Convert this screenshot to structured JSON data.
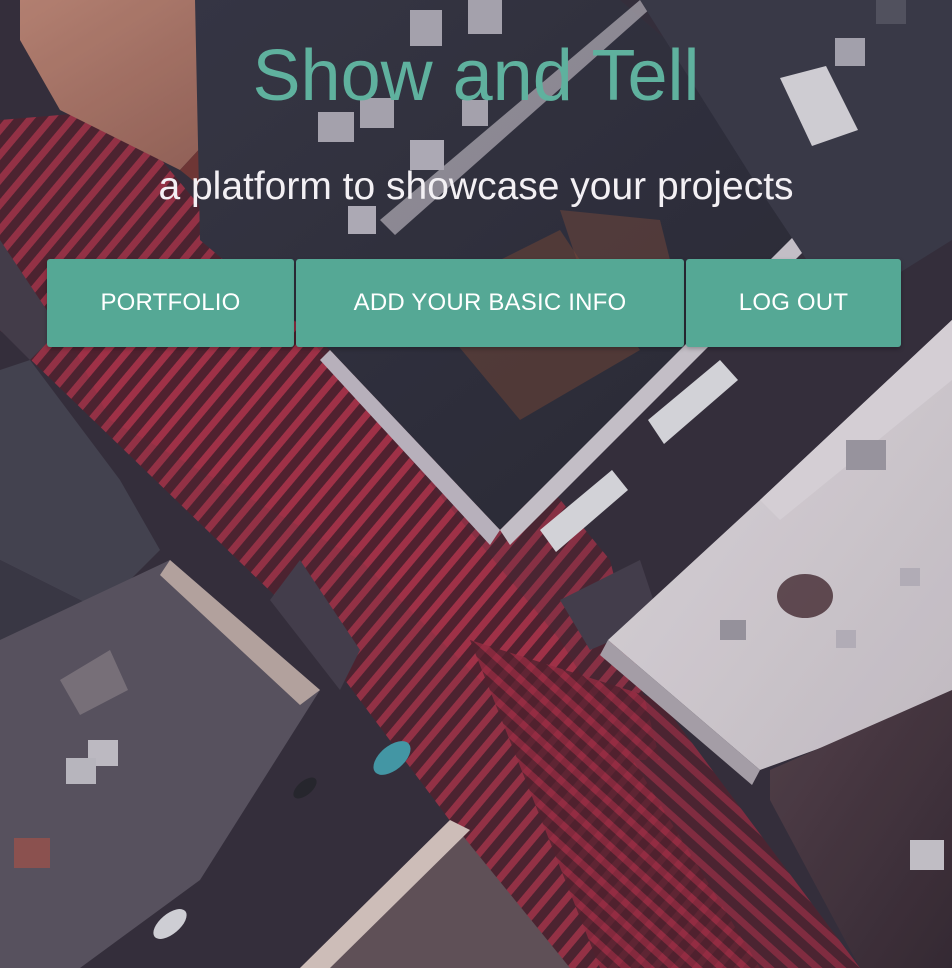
{
  "header": {
    "title": "Show and Tell",
    "subtitle": "a platform to showcase your projects"
  },
  "nav": {
    "portfolio_label": "PORTFOLIO",
    "basic_info_label": "ADD YOUR BASIC INFO",
    "logout_label": "LOG OUT"
  },
  "colors": {
    "accent": "#55a895",
    "title": "#5fb19e",
    "subtitle": "#f3f0f4",
    "crosswalk": "#a82f45"
  }
}
